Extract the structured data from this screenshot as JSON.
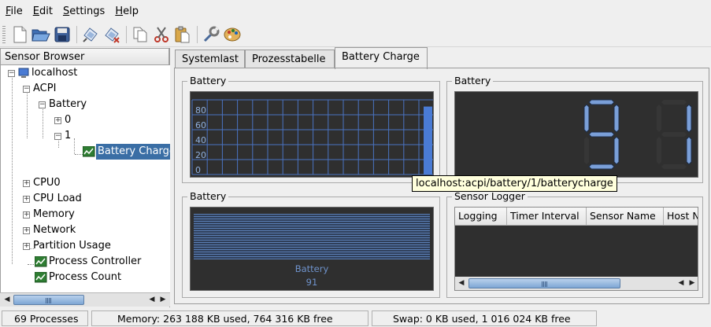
{
  "menu": [
    {
      "key": "F",
      "rest": "ile"
    },
    {
      "key": "E",
      "rest": "dit"
    },
    {
      "key": "S",
      "rest": "ettings"
    },
    {
      "key": "H",
      "rest": "elp"
    }
  ],
  "toolbar": {
    "icons": [
      "new-icon",
      "open-icon",
      "save-icon",
      "connect-host-icon",
      "disconnect-host-icon",
      "copy-icon",
      "cut-icon",
      "paste-icon",
      "configure-icon",
      "color-palette-icon"
    ]
  },
  "sidebar": {
    "title": "Sensor Browser",
    "tree": {
      "host": "localhost",
      "acpi": "ACPI",
      "battery": "Battery",
      "b0": "0",
      "b1": "1",
      "battery_charge": "Battery Charge",
      "cpu0": "CPU0",
      "cpu_load": "CPU Load",
      "memory": "Memory",
      "network": "Network",
      "partition_usage": "Partition Usage",
      "process_controller": "Process Controller",
      "process_count": "Process Count"
    }
  },
  "tabs": [
    {
      "label": "Systemlast",
      "active": false
    },
    {
      "label": "Prozesstabelle",
      "active": false
    },
    {
      "label": "Battery Charge",
      "active": true
    }
  ],
  "worksheet": {
    "plotter": {
      "title": "Battery",
      "y_ticks": [
        "80",
        "60",
        "40",
        "20",
        "0"
      ],
      "current_value": 91,
      "max_value": 100
    },
    "digital": {
      "title": "Battery",
      "value": "91"
    },
    "bargraph": {
      "title": "Battery",
      "label": "Battery",
      "value": "91"
    },
    "logger": {
      "title": "Sensor Logger",
      "columns": [
        "Logging",
        "Timer Interval",
        "Sensor Name",
        "Host N"
      ]
    }
  },
  "tooltip": "localhost:acpi/battery/1/batterycharge",
  "status": {
    "processes": "69 Processes",
    "memory": "Memory: 263 188 KB used, 764 316 KB free",
    "swap": "Swap: 0 KB used, 1 016 024 KB free"
  },
  "colors": {
    "display_bg": "#2f2f2f",
    "grid": "#4a73c2",
    "accent": "#4a7bd4",
    "digit_on": "#7a9fd8",
    "selection": "#3a6ea5"
  }
}
